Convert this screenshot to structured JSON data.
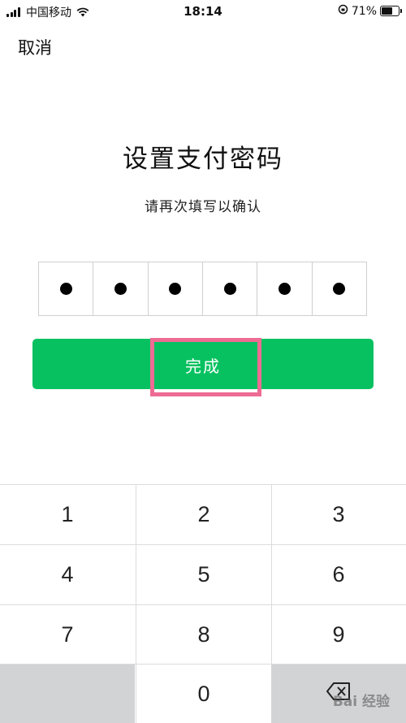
{
  "status_bar": {
    "carrier": "中国移动",
    "time": "18:14",
    "battery": "71%",
    "battery_level": 0.71
  },
  "header": {
    "cancel_label": "取消"
  },
  "main": {
    "title": "设置支付密码",
    "subtitle": "请再次填写以确认",
    "pin_filled": 6,
    "done_label": "完成"
  },
  "keypad": {
    "keys": [
      "1",
      "2",
      "3",
      "4",
      "5",
      "6",
      "7",
      "8",
      "9",
      "0"
    ]
  },
  "watermark": "Bai 经验",
  "colors": {
    "accent": "#07c160",
    "highlight": "#ee6b94",
    "key_gray": "#d2d3d5"
  }
}
